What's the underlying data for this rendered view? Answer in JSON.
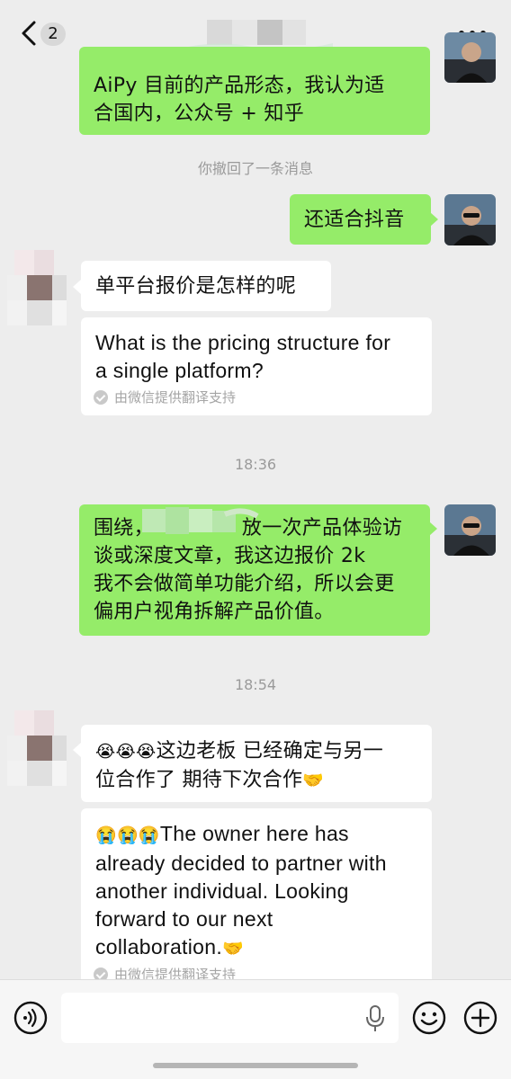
{
  "header": {
    "unread_count": "2"
  },
  "messages": {
    "m1_line1": "AiPy 目前的产品形态，我认为适",
    "m1_line2": "合国内，公众号 + 知乎",
    "recall_notice": "你撤回了一条消息",
    "m2_text": "还适合抖音",
    "m3_text": "单平台报价是怎样的呢",
    "m3_translation_line1": "What is the pricing structure for",
    "m3_translation_line2": "a single platform?",
    "translation_note": "由微信提供翻译支持",
    "time1": "18:36",
    "m4_line1_a": "围绕，",
    "m4_line1_b": "放一次产品体验访",
    "m4_line2": "谈或深度文章，我这边报价 2k",
    "m4_line3": "我不会做简单功能介绍，所以会更",
    "m4_line4": "偏用户视角拆解产品价值。",
    "time2": "18:54",
    "m5_emojis": "😭😭😭",
    "m5_line1": "这边老板 已经确定与另一",
    "m5_line2": "位合作了 期待下次合作",
    "m5_handshake": "🤝",
    "m5_tr_line1": "The owner here has",
    "m5_tr_line2": "already decided to partner with",
    "m5_tr_line3": "another individual. Looking",
    "m5_tr_line4": "forward to our next",
    "m5_tr_line5": "collaboration."
  },
  "icons": {
    "back": "chevron-left-icon",
    "more": "more-dots-icon",
    "voice": "voice-icon",
    "mic": "microphone-icon",
    "emoji": "emoji-icon",
    "add": "plus-icon"
  },
  "colors": {
    "my_bubble": "#95ec69",
    "their_bubble": "#ffffff",
    "background": "#ededed"
  }
}
